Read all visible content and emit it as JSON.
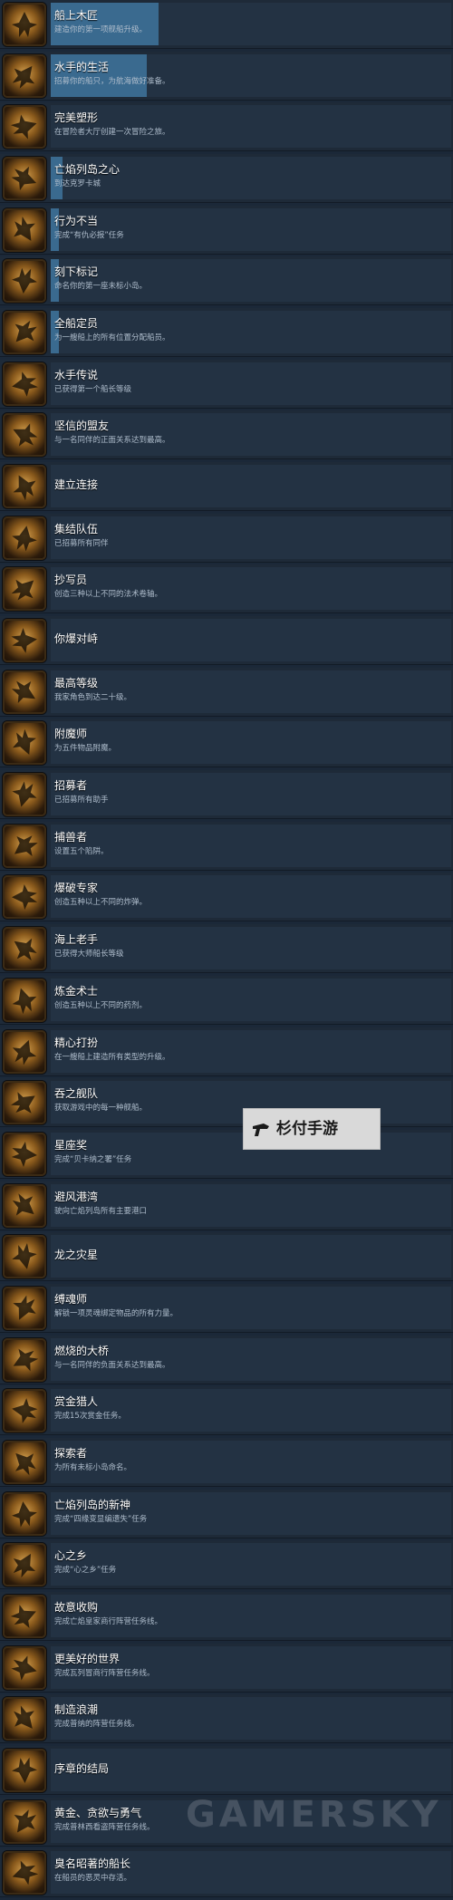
{
  "achievements": [
    {
      "title": "船上木匠",
      "description": "建造你的第一项舰船升级。",
      "progress": 0.27,
      "icon": "hammer-icon"
    },
    {
      "title": "水手的生活",
      "description": "招募你的船只，为航海做好准备。",
      "progress": 0.24,
      "icon": "sailor-icon"
    },
    {
      "title": "完美塑形",
      "description": "在冒险者大厅创建一次冒险之旅。",
      "progress": 0.0,
      "icon": "mask-icon"
    },
    {
      "title": "亡焰列岛之心",
      "description": "到达克罗卡城",
      "progress": 0.03,
      "icon": "flame-icon"
    },
    {
      "title": "行为不当",
      "description": "完成“有仇必报”任务",
      "progress": 0.02,
      "icon": "flag-icon"
    },
    {
      "title": "刻下标记",
      "description": "命名你的第一座未标小岛。",
      "progress": 0.02,
      "icon": "quill-icon"
    },
    {
      "title": "全船定员",
      "description": "为一艘船上的所有位置分配船员。",
      "progress": 0.02,
      "icon": "crew-icon"
    },
    {
      "title": "水手传说",
      "description": "已获得第一个船长等级",
      "progress": 0.0,
      "icon": "star-icon"
    },
    {
      "title": "坚信的盟友",
      "description": "与一名同伴的正面关系达到最高。",
      "progress": 0.0,
      "icon": "ally-icon"
    },
    {
      "title": "建立连接",
      "description": "",
      "progress": 0.0,
      "icon": "link-icon"
    },
    {
      "title": "集结队伍",
      "description": "已招募所有同伴",
      "progress": 0.0,
      "icon": "party-icon"
    },
    {
      "title": "抄写员",
      "description": "创造三种以上不同的法术卷轴。",
      "progress": 0.0,
      "icon": "scroll-icon"
    },
    {
      "title": "你爆对峙",
      "description": "",
      "progress": 0.0,
      "icon": "blade-icon"
    },
    {
      "title": "最高等级",
      "description": "我家角色到达二十级。",
      "progress": 0.0,
      "icon": "level-icon"
    },
    {
      "title": "附魔师",
      "description": "为五件物品附魔。",
      "progress": 0.0,
      "icon": "enchant-icon"
    },
    {
      "title": "招募者",
      "description": "已招募所有助手",
      "progress": 0.0,
      "icon": "recruit-icon"
    },
    {
      "title": "捕兽者",
      "description": "设置五个陷阱。",
      "progress": 0.0,
      "icon": "trap-icon"
    },
    {
      "title": "爆破专家",
      "description": "创造五种以上不同的炸弹。",
      "progress": 0.0,
      "icon": "bomb-icon"
    },
    {
      "title": "海上老手",
      "description": "已获得大师船长等级",
      "progress": 0.0,
      "icon": "stars-icon"
    },
    {
      "title": "炼金术士",
      "description": "创造五种以上不同的药剂。",
      "progress": 0.0,
      "icon": "potion-icon"
    },
    {
      "title": "精心打扮",
      "description": "在一艘船上建造所有类型的升级。",
      "progress": 0.0,
      "icon": "ship-icon"
    },
    {
      "title": "吞之舰队",
      "description": "获取游戏中的每一种舰船。",
      "progress": 0.0,
      "icon": "fleet-icon"
    },
    {
      "title": "星座奖",
      "description": "完成“贝卡纳之署”任务",
      "progress": 0.0,
      "icon": "constellation-icon"
    },
    {
      "title": "避风港湾",
      "description": "驶向亡焰列岛所有主要港口",
      "progress": 0.0,
      "icon": "globe-icon"
    },
    {
      "title": "龙之灾星",
      "description": "",
      "progress": 0.0,
      "icon": "dragon-icon"
    },
    {
      "title": "缚魂师",
      "description": "解锁一项灵魂绑定物品的所有力量。",
      "progress": 0.0,
      "icon": "soul-icon"
    },
    {
      "title": "燃烧的大桥",
      "description": "与一名同伴的负面关系达到最高。",
      "progress": 0.0,
      "icon": "bridge-icon"
    },
    {
      "title": "赏金猎人",
      "description": "完成15次赏金任务。",
      "progress": 0.0,
      "icon": "bounty-icon"
    },
    {
      "title": "探索者",
      "description": "为所有未标小岛命名。",
      "progress": 0.0,
      "icon": "explorer-icon"
    },
    {
      "title": "亡焰列岛的新神",
      "description": "完成“四缘变显编遗失”任务",
      "progress": 0.0,
      "icon": "god-icon"
    },
    {
      "title": "心之乡",
      "description": "完成“心之乡”任务",
      "progress": 0.0,
      "icon": "heart-icon"
    },
    {
      "title": "故意收购",
      "description": "完成亡焰皇家商行阵营任务线。",
      "progress": 0.0,
      "icon": "acquire-icon"
    },
    {
      "title": "更美好的世界",
      "description": "完成瓦列冒商行阵营任务线。",
      "progress": 0.0,
      "icon": "scales-icon"
    },
    {
      "title": "制造浪潮",
      "description": "完成普纳的阵营任务线。",
      "progress": 0.0,
      "icon": "wave-icon"
    },
    {
      "title": "序章的结局",
      "description": "",
      "progress": 0.0,
      "icon": "prologue-icon"
    },
    {
      "title": "黄金、贪欲与勇气",
      "description": "完成普林西看盗阵营任务线。",
      "progress": 0.0,
      "icon": "gold-icon"
    },
    {
      "title": "臭名昭著的船长",
      "description": "在船员的恶灵中存活。",
      "progress": 0.0,
      "icon": "captain-icon"
    }
  ],
  "watermark": {
    "text": "杉付手游",
    "icon": "hand-icon"
  },
  "watermark2": {
    "text": "GAMERSKY"
  }
}
